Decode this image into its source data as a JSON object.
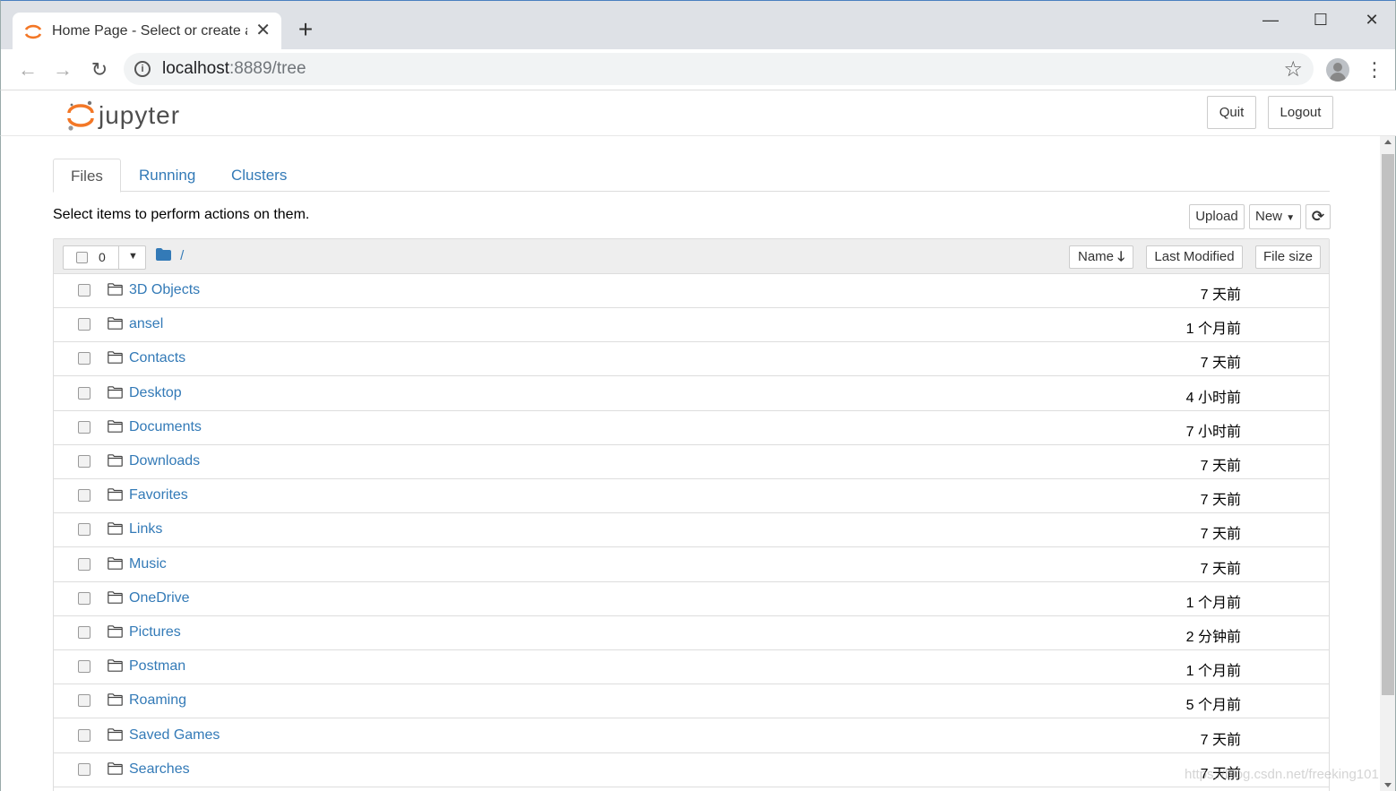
{
  "browser": {
    "tab_title": "Home Page - Select or create a notebook",
    "new_tab_icon": "plus-icon",
    "url_host": "localhost",
    "url_rest": ":8889/tree"
  },
  "header": {
    "logo_text": "jupyter",
    "quit_label": "Quit",
    "logout_label": "Logout"
  },
  "tabs": [
    {
      "label": "Files",
      "active": true
    },
    {
      "label": "Running",
      "active": false
    },
    {
      "label": "Clusters",
      "active": false
    }
  ],
  "toolbar": {
    "hint": "Select items to perform actions on them.",
    "upload_label": "Upload",
    "new_label": "New",
    "refresh_icon": "refresh-icon"
  },
  "list_header": {
    "selected_count": "0",
    "breadcrumb": "/",
    "name_label": "Name",
    "last_modified_label": "Last Modified",
    "file_size_label": "File size"
  },
  "files": [
    {
      "name": "3D Objects",
      "modified": "7 天前"
    },
    {
      "name": "ansel",
      "modified": "1 个月前"
    },
    {
      "name": "Contacts",
      "modified": "7 天前"
    },
    {
      "name": "Desktop",
      "modified": "4 小时前"
    },
    {
      "name": "Documents",
      "modified": "7 小时前"
    },
    {
      "name": "Downloads",
      "modified": "7 天前"
    },
    {
      "name": "Favorites",
      "modified": "7 天前"
    },
    {
      "name": "Links",
      "modified": "7 天前"
    },
    {
      "name": "Music",
      "modified": "7 天前"
    },
    {
      "name": "OneDrive",
      "modified": "1 个月前"
    },
    {
      "name": "Pictures",
      "modified": "2 分钟前"
    },
    {
      "name": "Postman",
      "modified": "1 个月前"
    },
    {
      "name": "Roaming",
      "modified": "5 个月前"
    },
    {
      "name": "Saved Games",
      "modified": "7 天前"
    },
    {
      "name": "Searches",
      "modified": "7 天前"
    }
  ],
  "watermark": "https://blog.csdn.net/freeking101",
  "colors": {
    "link": "#337ab7",
    "jupyter_orange": "#f37726"
  }
}
